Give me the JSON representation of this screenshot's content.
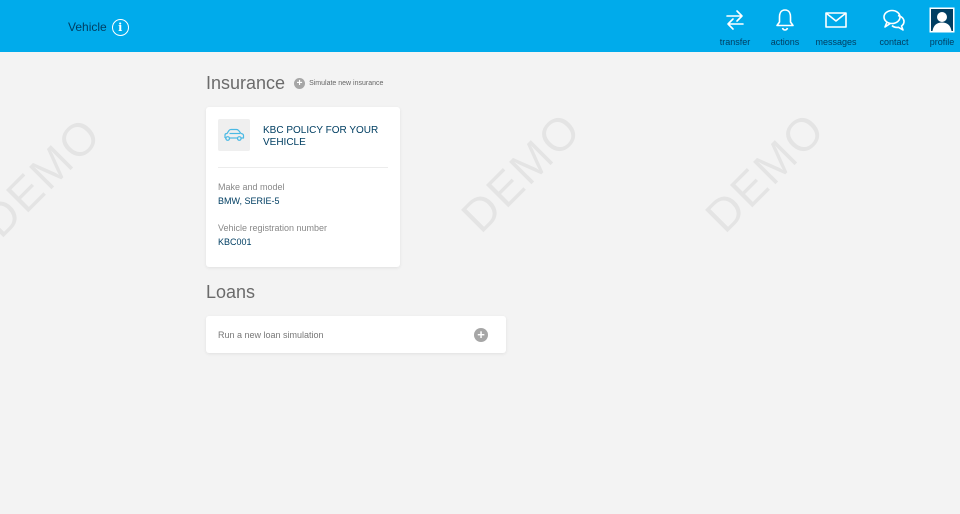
{
  "header": {
    "title": "Vehicle",
    "info_icon": "info-icon",
    "nav": [
      {
        "label": "transfer",
        "icon": "transfer-icon"
      },
      {
        "label": "actions",
        "icon": "bell-icon"
      },
      {
        "label": "messages",
        "icon": "envelope-icon"
      },
      {
        "label": "contact",
        "icon": "chat-icon"
      },
      {
        "label": "profile",
        "icon": "user-icon"
      }
    ]
  },
  "watermark": "DEMO",
  "insurance": {
    "title": "Insurance",
    "simulate_label": "Simulate new insurance",
    "policy": {
      "name": "KBC POLICY FOR YOUR VEHICLE",
      "icon": "car-icon",
      "make_label": "Make and model",
      "make_value": "BMW, SERIE-5",
      "reg_label": "Vehicle registration number",
      "reg_value": "KBC001"
    }
  },
  "loans": {
    "title": "Loans",
    "simulation_label": "Run a new loan simulation"
  },
  "colors": {
    "header_bg": "#00abeb",
    "header_text": "#003e62",
    "page_bg": "#f3f3f3",
    "accent_dark": "#003e62"
  }
}
